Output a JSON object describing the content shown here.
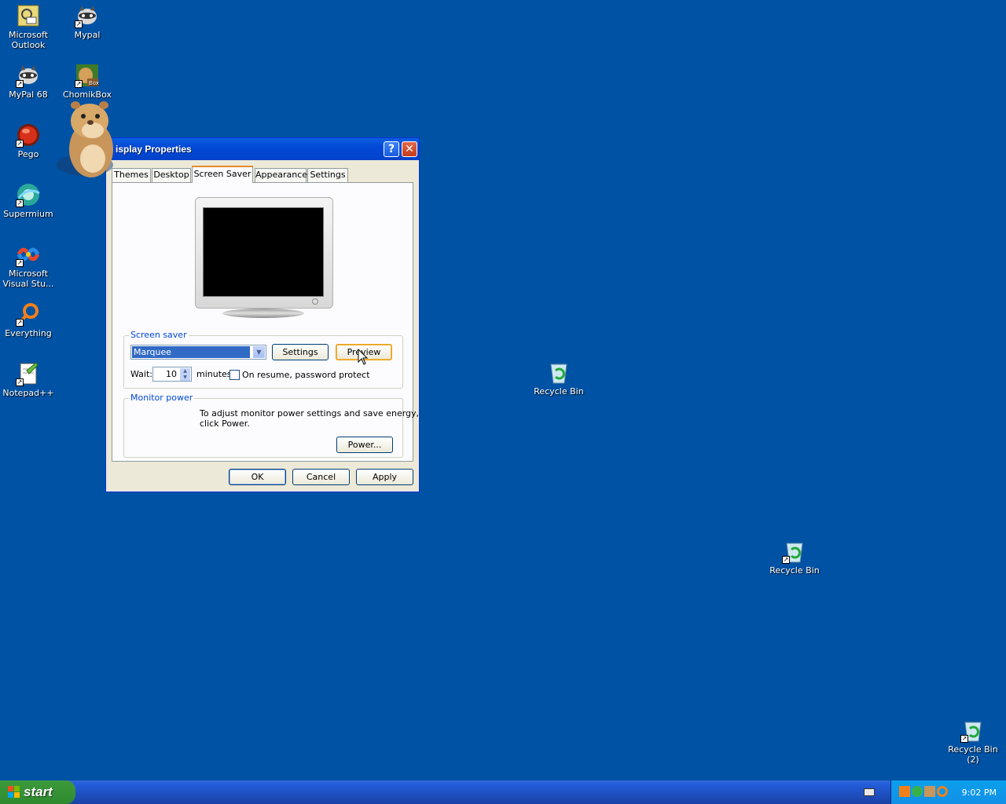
{
  "desktop": {
    "icons": [
      {
        "label": "Microsoft Outlook",
        "icon": "outlook-icon"
      },
      {
        "label": "Mypal",
        "icon": "raccoon-icon"
      },
      {
        "label": "MyPal 68",
        "icon": "raccoon-icon"
      },
      {
        "label": "ChomikBox",
        "icon": "hamster-box-icon"
      },
      {
        "label": "Pego",
        "icon": "red-orb-icon"
      },
      {
        "label": "Supermium",
        "icon": "supermium-icon"
      },
      {
        "label": "Microsoft Visual Stu...",
        "icon": "visual-studio-icon"
      },
      {
        "label": "Everything",
        "icon": "magnifier-icon"
      },
      {
        "label": "Notepad++",
        "icon": "notepad-plus-icon"
      },
      {
        "label": "Recycle Bin",
        "icon": "recycle-bin-icon"
      },
      {
        "label": "Recycle Bin",
        "icon": "recycle-bin-icon"
      },
      {
        "label": "Recycle Bin (2)",
        "icon": "recycle-bin-icon"
      }
    ]
  },
  "dialog": {
    "title": "isplay Properties",
    "help_glyph": "?",
    "close_glyph": "✕",
    "tabs": [
      "Themes",
      "Desktop",
      "Screen Saver",
      "Appearance",
      "Settings"
    ],
    "active_tab": "Screen Saver",
    "screensaver_group": {
      "label": "Screen saver",
      "selected": "Marquee",
      "settings_button": "Settings",
      "preview_button": "Preview",
      "wait_label": "Wait:",
      "wait_value": "10",
      "minutes_label": "minutes",
      "password_label": "On resume, password protect"
    },
    "monitor_group": {
      "label": "Monitor power",
      "text_line1": "To adjust monitor power settings and save energy,",
      "text_line2": "click Power.",
      "power_button": "Power..."
    },
    "buttons": {
      "ok": "OK",
      "cancel": "Cancel",
      "apply": "Apply"
    }
  },
  "taskbar": {
    "start_label": "start",
    "clock": "9:02 PM"
  },
  "colors": {
    "desktop_bg": "#0052a4",
    "title_bar": "#0249d6",
    "taskbar": "#245edb",
    "start_green": "#3c9a3c"
  }
}
